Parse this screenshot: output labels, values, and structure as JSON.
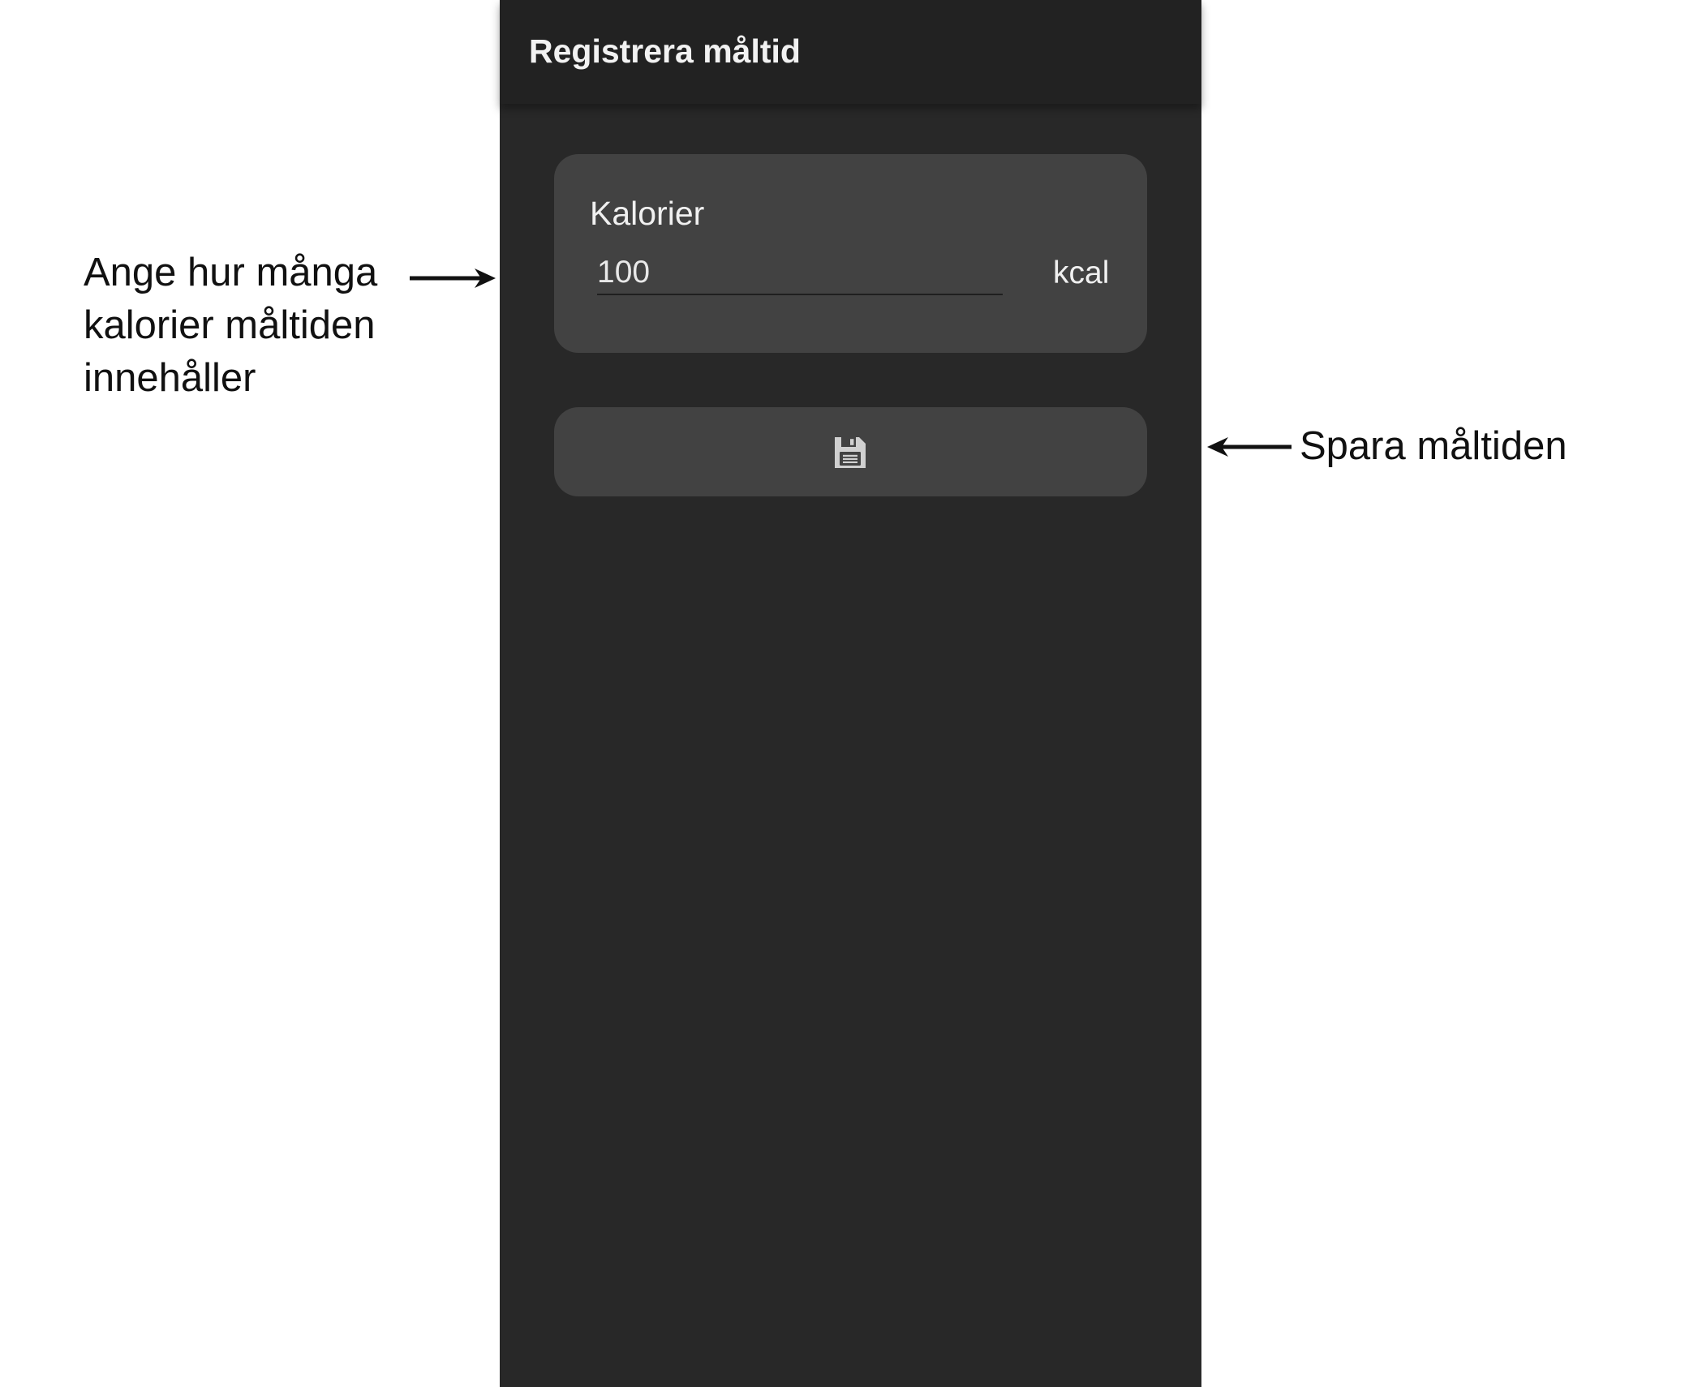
{
  "app_bar": {
    "title": "Registrera måltid"
  },
  "calorie_card": {
    "label": "Kalorier",
    "input_value": "100",
    "unit": "kcal"
  },
  "save_button": {
    "icon": "floppy-disk-icon"
  },
  "annotations": {
    "calorie_hint_lines": [
      "Ange hur många",
      "kalorier måltiden",
      "innehåller"
    ],
    "save_hint": "Spara måltiden"
  },
  "colors": {
    "screen_background": "#282828",
    "app_bar_background": "#222222",
    "card_background": "#424242",
    "text_primary": "#f0f0f0",
    "icon_color": "#d0d0d0",
    "annotation_text": "#111111"
  }
}
